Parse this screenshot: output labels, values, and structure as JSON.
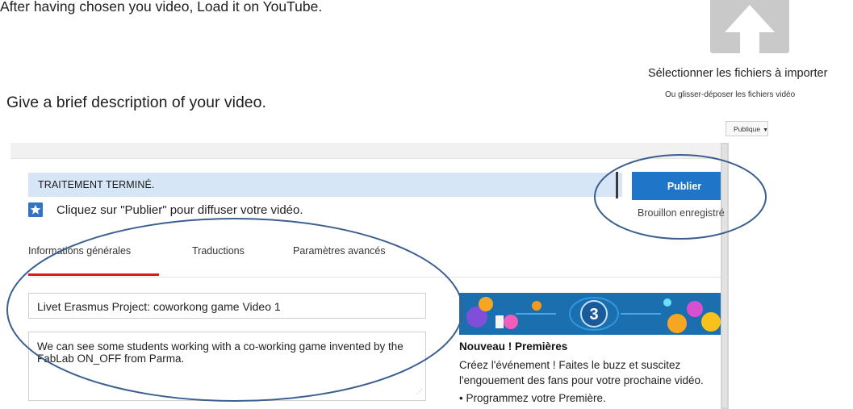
{
  "doc": {
    "line1": "After having chosen you video, Load it on YouTube.",
    "line2": "Give a brief description of your video."
  },
  "upload": {
    "select_label": "Sélectionner les fichiers à importer",
    "drag_label": "Ou glisser-déposer les fichiers vidéo",
    "visibility": "Publique",
    "tile_color": "#c9c9c9"
  },
  "studio": {
    "banner": "TRAITEMENT TERMINÉ.",
    "publish": "Publier",
    "draft_status": "Brouillon enregistré",
    "hint": "Cliquez sur \"Publier\" pour diffuser votre vidéo.",
    "tabs": [
      {
        "label": "Informations générales",
        "active": true
      },
      {
        "label": "Traductions",
        "active": false
      },
      {
        "label": "Paramètres avancés",
        "active": false
      }
    ],
    "title_value": "Livet Erasmus Project: coworkong game Video 1",
    "description_value": "We can see some students working with a co-working game invented by the FabLab ON_OFF from Parma.",
    "promo": {
      "badge_number": "3",
      "title": "Nouveau ! Premières",
      "body": "Créez l'événement ! Faites le buzz et suscitez l'engouement des fans pour votre prochaine vidéo.",
      "bullet": "• Programmez votre Première."
    },
    "colors": {
      "banner_bg": "#d6e6f6",
      "publish_bg": "#1f75c7",
      "tab_active": "#e01818",
      "annotation": "#3b5f8f"
    }
  },
  "icons": {
    "upload": "upload-arrow-icon",
    "hint": "star-icon"
  }
}
